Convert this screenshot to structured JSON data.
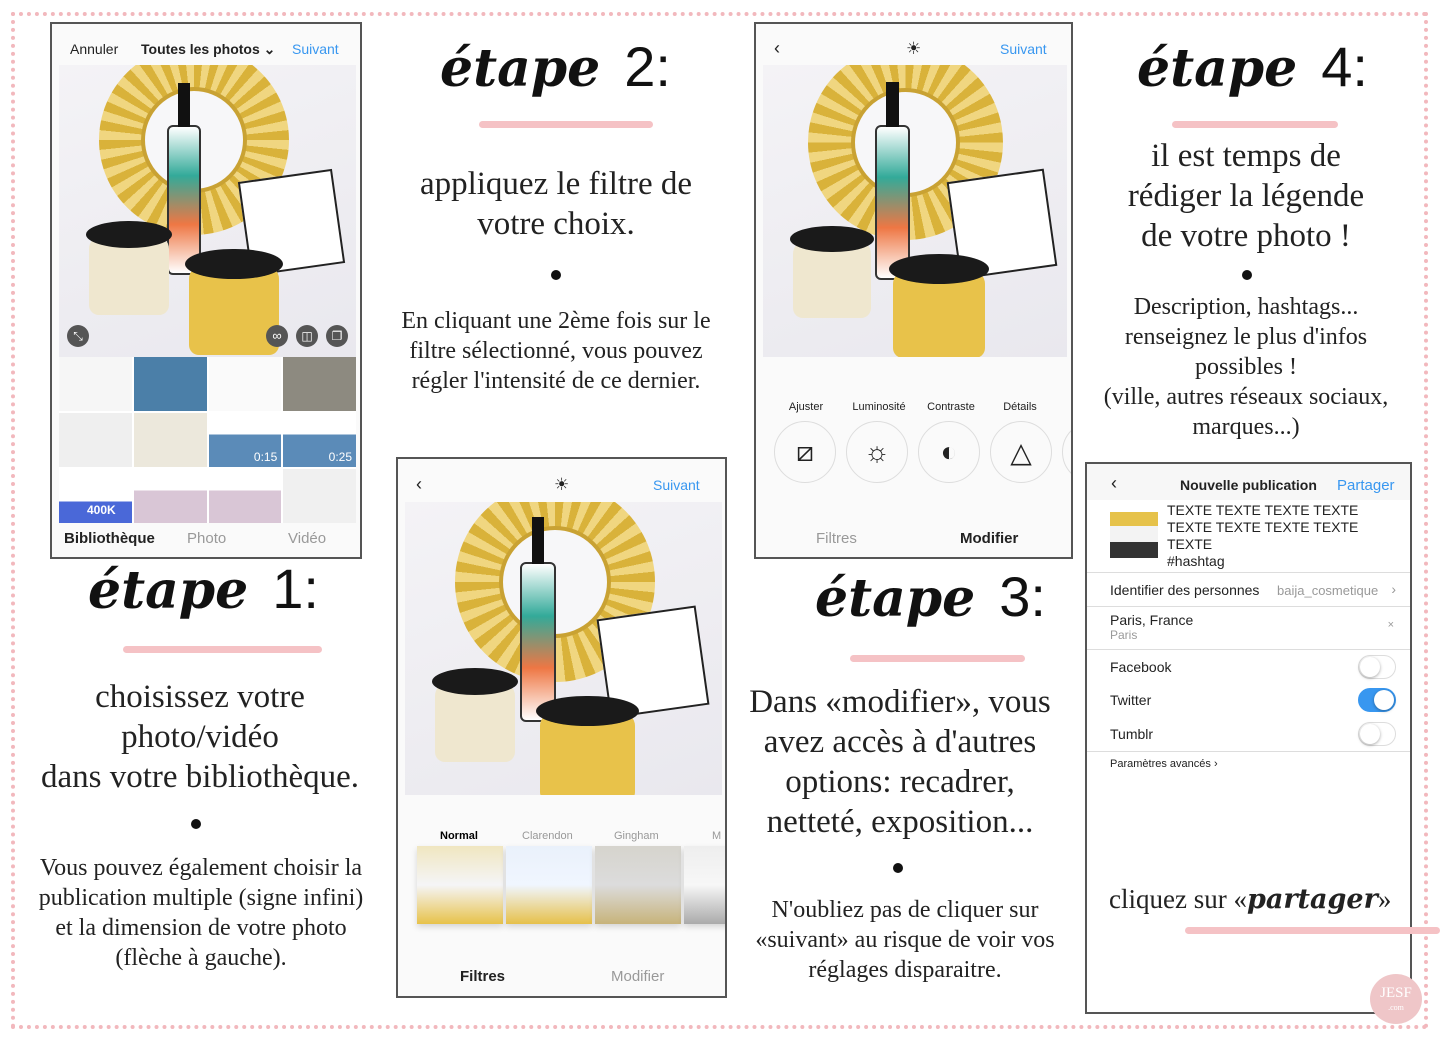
{
  "colors": {
    "accent_pink": "#f5c2c5",
    "ig_blue": "#3897f0",
    "border_dots": "#f2b8bd"
  },
  "step1": {
    "title": "étape",
    "num": "1:",
    "text": [
      "choisissez votre",
      "photo/vidéo",
      "dans votre bibliothèque."
    ],
    "note": [
      "Vous pouvez également choisir la",
      "publication multiple (signe infini)",
      "et la dimension de votre photo",
      "(flèche à gauche)."
    ],
    "phone": {
      "cancel": "Annuler",
      "album": "Toutes les photos",
      "next": "Suivant",
      "grid_durations": [
        "0:15",
        "0:25"
      ],
      "grid_badge": "400K",
      "tabs": [
        "Bibliothèque",
        "Photo",
        "Vidéo"
      ],
      "icons": [
        "expand-icon",
        "infinity-icon",
        "layout-icon",
        "multi-select-icon"
      ]
    }
  },
  "step2": {
    "title": "étape",
    "num": "2:",
    "text": [
      "appliquez le filtre de",
      "votre choix."
    ],
    "note": [
      "En cliquant une 2ème fois sur le",
      "filtre sélectionné, vous pouvez",
      "régler l'intensité de ce dernier."
    ],
    "phone": {
      "next": "Suivant",
      "filters": [
        "Normal",
        "Clarendon",
        "Gingham",
        "M"
      ],
      "tabs": [
        "Filtres",
        "Modifier"
      ],
      "active_tab": "Filtres"
    }
  },
  "step3": {
    "title": "étape",
    "num": "3:",
    "text": [
      "Dans «modifier», vous",
      "avez accès à d'autres",
      "options: recadrer,",
      "netteté, exposition..."
    ],
    "note": [
      "N'oubliez pas de cliquer sur",
      "«suivant» au risque de voir vos",
      "réglages disparaitre."
    ],
    "phone": {
      "next": "Suivant",
      "tools": [
        {
          "label": "Ajuster",
          "icon": "adjust-icon"
        },
        {
          "label": "Luminosité",
          "icon": "brightness-icon"
        },
        {
          "label": "Contraste",
          "icon": "contrast-icon"
        },
        {
          "label": "Détails",
          "icon": "details-icon"
        }
      ],
      "tabs": [
        "Filtres",
        "Modifier"
      ],
      "active_tab": "Modifier"
    }
  },
  "step4": {
    "title": "étape",
    "num": "4:",
    "text": [
      "il est temps de",
      "rédiger la légende",
      "de votre photo !"
    ],
    "note": [
      "Description, hashtags...",
      "renseignez le plus d'infos",
      "possibles !",
      "(ville, autres réseaux sociaux,",
      "marques...)"
    ],
    "phone": {
      "title": "Nouvelle publication",
      "share": "Partager",
      "caption": [
        "TEXTE TEXTE TEXTE TEXTE",
        "TEXTE TEXTE TEXTE TEXTE",
        "TEXTE",
        "#hashtag"
      ],
      "tag_label": "Identifier des personnes",
      "tag_value": "baija_cosmetique",
      "location": "Paris, France",
      "location_sub": "Paris",
      "shares": [
        {
          "name": "Facebook",
          "on": false
        },
        {
          "name": "Twitter",
          "on": true
        },
        {
          "name": "Tumblr",
          "on": false
        }
      ],
      "advanced": "Paramètres avancés"
    },
    "cta_prefix": "cliquez sur «",
    "cta_word": "partager",
    "cta_suffix": "»"
  },
  "logo": {
    "text": "JESF",
    "sub": ".com"
  }
}
